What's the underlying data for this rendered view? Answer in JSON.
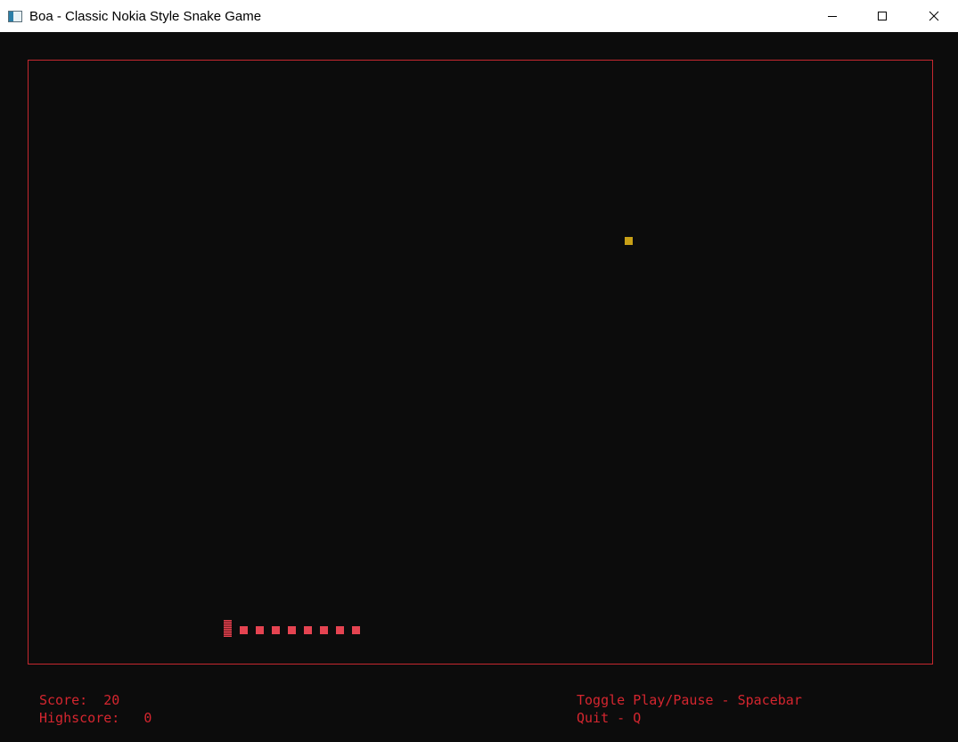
{
  "window": {
    "title": "Boa - Classic Nokia Style Snake Game",
    "controls": [
      "minimize-icon",
      "maximize-icon",
      "close-icon"
    ]
  },
  "game": {
    "snake_length": 9,
    "direction": "left",
    "food_color": "#c8a017",
    "snake_color": "#e54451",
    "border_color": "#c5282f",
    "background": "#0c0c0c"
  },
  "hud": {
    "score_label": "Score:",
    "score_value": "20",
    "highscore_label": "Highscore:",
    "highscore_value": "0",
    "help_toggle": "Toggle Play/Pause - Spacebar",
    "help_quit": "Quit - Q"
  }
}
